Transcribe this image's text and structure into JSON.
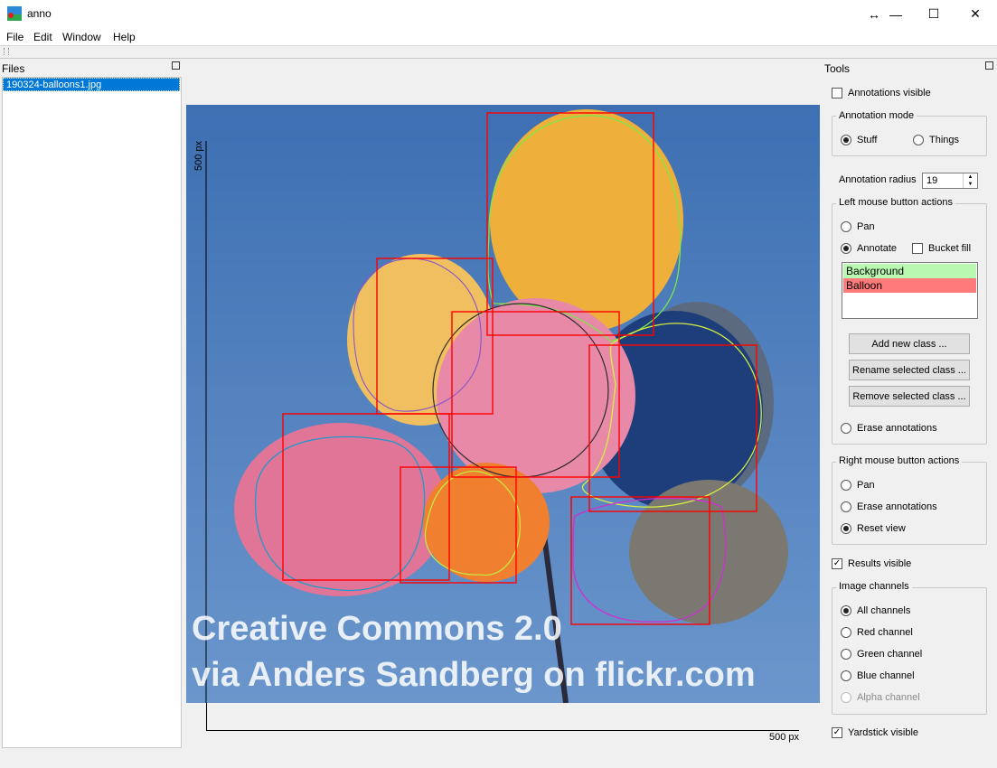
{
  "window": {
    "title": "anno",
    "resize_glyph": "↔",
    "minimize_glyph": "—",
    "maximize_glyph": "☐",
    "close_glyph": "✕"
  },
  "menu": [
    "File",
    "Edit",
    "Window",
    "Help"
  ],
  "files": {
    "title": "Files",
    "items": [
      "190324-balloons1.jpg"
    ]
  },
  "canvas": {
    "watermark_line1": "Creative Commons 2.0",
    "watermark_line2": "via Anders Sandberg on flickr.com",
    "yardstick_y": "500 px",
    "yardstick_x": "500 px"
  },
  "tools": {
    "title": "Tools",
    "annotations_visible": {
      "label": "Annotations visible",
      "checked": false
    },
    "annotation_mode": {
      "title": "Annotation mode",
      "options": [
        "Stuff",
        "Things"
      ],
      "selected": "Stuff"
    },
    "annotation_radius": {
      "label": "Annotation radius",
      "value": "19"
    },
    "left_mouse": {
      "title": "Left mouse button actions",
      "pan": "Pan",
      "annotate": "Annotate",
      "bucket_fill": "Bucket fill",
      "selected": "Annotate",
      "classes": [
        {
          "name": "Background",
          "color": "#b9f8b0"
        },
        {
          "name": "Balloon",
          "color": "#ff7b7b"
        }
      ],
      "add_class": "Add new class ...",
      "rename_class": "Rename selected class ...",
      "remove_class": "Remove selected class ...",
      "erase": "Erase annotations"
    },
    "right_mouse": {
      "title": "Right mouse button actions",
      "options": [
        "Pan",
        "Erase annotations",
        "Reset view"
      ],
      "selected": "Reset view"
    },
    "results_visible": {
      "label": "Results visible",
      "checked": true
    },
    "image_channels": {
      "title": "Image channels",
      "options": [
        "All channels",
        "Red channel",
        "Green channel",
        "Blue channel",
        "Alpha channel"
      ],
      "selected": "All channels",
      "disabled": [
        "Alpha channel"
      ]
    },
    "yardstick_visible": {
      "label": "Yardstick visible",
      "checked": true
    }
  },
  "colors": {
    "selection": "#0078d7",
    "bbox": "#ff0000",
    "sky": "#4a78b8"
  }
}
